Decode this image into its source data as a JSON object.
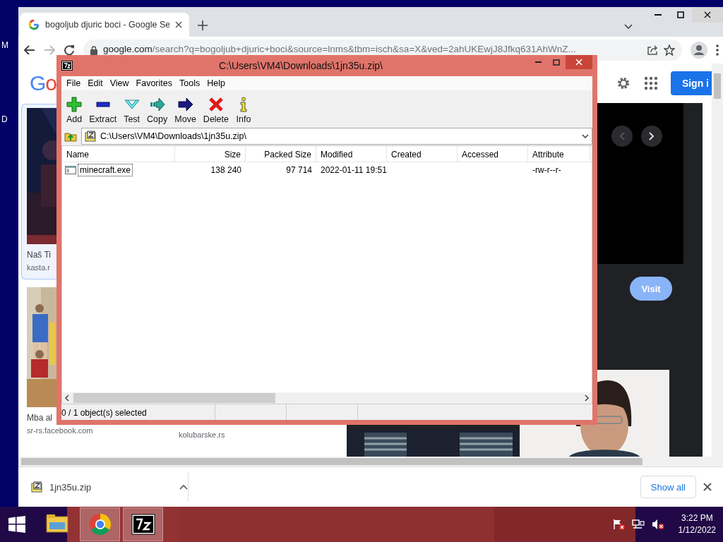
{
  "desktop": {
    "icon_labels": [
      "M",
      "D"
    ]
  },
  "browser": {
    "tabs": [
      {
        "title": "bogoljub djuric boci - Google Se",
        "selected": true
      }
    ],
    "nav": {
      "back_disabled": false,
      "forward_disabled": true
    },
    "url": {
      "host": "google.com",
      "path": "/search?q=bogoljub+djuric+boci&source=lnms&tbm=isch&sa=X&ved=2ahUKEwjJ8Jfkq631AhWnZ..."
    },
    "page": {
      "logo": "Go",
      "sign_in": "Sign i",
      "results": [
        {
          "title": "Naš Ti",
          "source": "kasta.r"
        },
        {
          "title": "Mba al",
          "source": "sr-rs.facebook.com"
        },
        {
          "source": "kolubarske.rs"
        }
      ],
      "visit": "Visit"
    },
    "downloads": {
      "file": "1jn35u.zip",
      "show_all": "Show all"
    }
  },
  "archiver": {
    "title": "C:\\Users\\VM4\\Downloads\\1jn35u.zip\\",
    "menu": [
      "File",
      "Edit",
      "View",
      "Favorites",
      "Tools",
      "Help"
    ],
    "toolbar": [
      {
        "label": "Add",
        "kind": "add"
      },
      {
        "label": "Extract",
        "kind": "extract"
      },
      {
        "label": "Test",
        "kind": "test"
      },
      {
        "label": "Copy",
        "kind": "copy"
      },
      {
        "label": "Move",
        "kind": "move"
      },
      {
        "label": "Delete",
        "kind": "delete"
      },
      {
        "label": "Info",
        "kind": "info"
      }
    ],
    "path": "C:\\Users\\VM4\\Downloads\\1jn35u.zip\\",
    "columns": [
      {
        "label": "Name",
        "kind": "text"
      },
      {
        "label": "Size",
        "kind": "number"
      },
      {
        "label": "Packed Size",
        "kind": "number"
      },
      {
        "label": "Modified",
        "kind": "text"
      },
      {
        "label": "Created",
        "kind": "text"
      },
      {
        "label": "Accessed",
        "kind": "text"
      },
      {
        "label": "Attribute",
        "kind": "text"
      }
    ],
    "rows": [
      {
        "cells": [
          "minecraft.exe",
          "138 240",
          "97 714",
          "2022-01-11 19:51",
          "",
          "",
          "-rw-r--r-"
        ],
        "selected": false,
        "focused": true
      }
    ],
    "status": "0 / 1 object(s) selected"
  },
  "taskbar": {
    "apps": [
      {
        "kind": "explorer",
        "active": false
      },
      {
        "kind": "chrome",
        "active": true
      },
      {
        "kind": "archiver",
        "active": true
      }
    ],
    "volume_muted": true,
    "time": "3:22 PM",
    "date": "1/12/2022"
  }
}
